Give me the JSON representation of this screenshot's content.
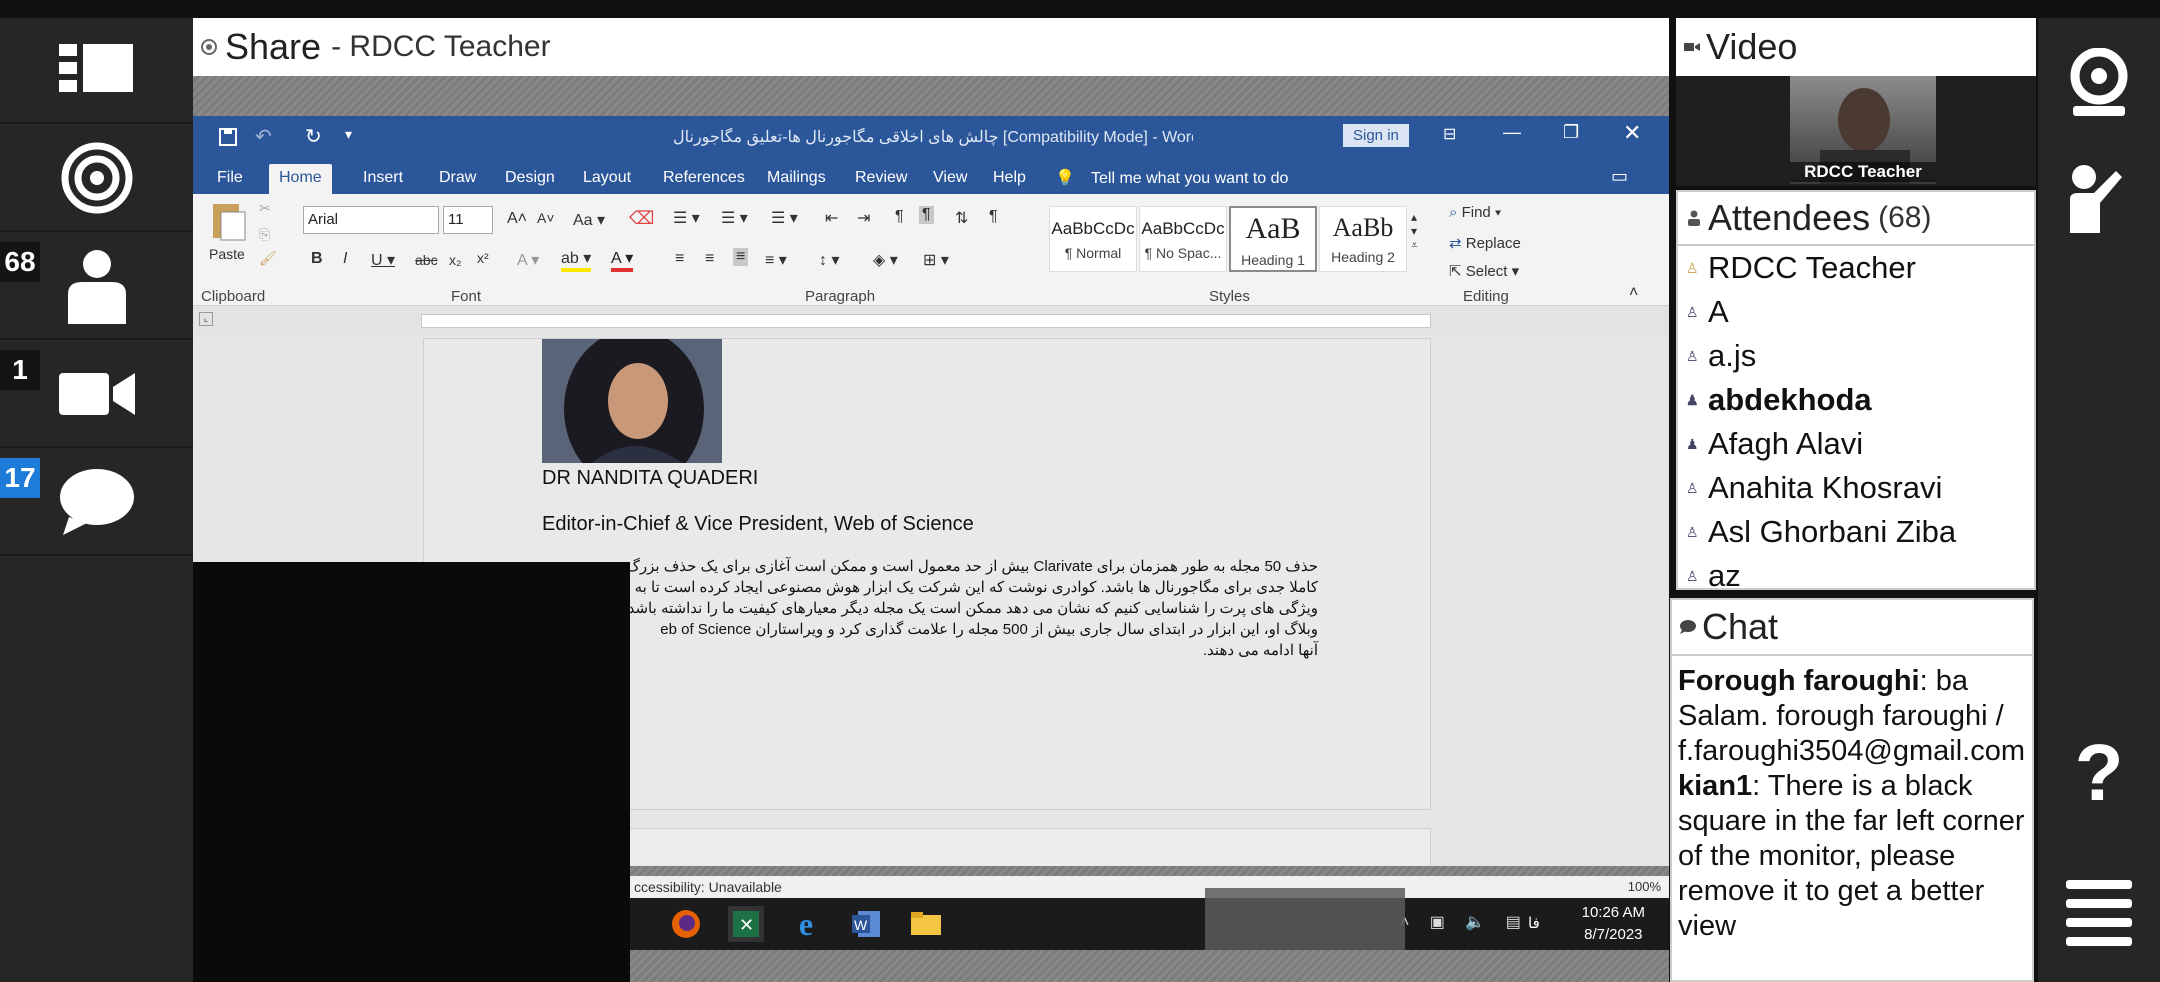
{
  "left_rail": {
    "items": [
      {
        "name": "layouts",
        "icon": "layout-grid-icon",
        "badge": ""
      },
      {
        "name": "broadcast",
        "icon": "target-icon",
        "badge": ""
      },
      {
        "name": "attendees",
        "icon": "person-icon",
        "badge": "68"
      },
      {
        "name": "video",
        "icon": "camera-icon",
        "badge": "1"
      },
      {
        "name": "chat",
        "icon": "chat-bubble-icon",
        "badge": "17"
      }
    ]
  },
  "right_rail": {
    "items": [
      "webcam-icon",
      "raise-hand-icon",
      "help-icon",
      "menu-icon"
    ],
    "help_label": "?"
  },
  "share_pod": {
    "title": "Share",
    "subtitle": "- RDCC Teacher"
  },
  "word": {
    "title": "چالش های اخلاقی مگاجورنال ها-تعلیق مگاجورنال [Compatibility Mode]  -  Word",
    "sign_in": "Sign in",
    "tabs": [
      "File",
      "Home",
      "Insert",
      "Draw",
      "Design",
      "Layout",
      "References",
      "Mailings",
      "Review",
      "View",
      "Help"
    ],
    "tell_me": "Tell me what you want to do",
    "font_name": "Arial",
    "font_size": "11",
    "paste_label": "Paste",
    "groups": [
      "Clipboard",
      "Font",
      "Paragraph",
      "Styles",
      "Editing"
    ],
    "styles": [
      {
        "preview": "AaBbCcDc",
        "name": "¶ Normal"
      },
      {
        "preview": "AaBbCcDc",
        "name": "¶ No Spac..."
      },
      {
        "preview": "AaB",
        "name": "Heading 1"
      },
      {
        "preview": "AaBb",
        "name": "Heading 2"
      }
    ],
    "editing": [
      "Find",
      "Replace",
      "Select"
    ],
    "doc": {
      "name": "DR NANDITA QUADERI",
      "role": "Editor-in-Chief & Vice President, Web of Science",
      "rtl_lines": [
        "حذف 50 مجله به طور همزمان برای Clarivate بیش از حد معمول است و ممکن است آغازی برای یک حذف بزرگ",
        "کاملا جدی برای مگاجورنال ها باشد. کوادری نوشت که این شرکت یک ابزار هوش مصنوعی ایجاد کرده است تا به",
        "ویژگی های پرت را شناسایی کنیم که نشان می دهد ممکن است یک مجله دیگر معیارهای کیفیت ما را نداشته باشد. بر",
        "وبلاگ او، این ابزار در ابتدای سال جاری بیش از 500 مجله را علامت گذاری کرد و ویراستاران eb of Science",
        "آنها ادامه می دهند."
      ]
    },
    "status_text": "ccessibility: Unavailable",
    "zoom": "100%",
    "clock_time": "10:26 AM",
    "clock_date": "8/7/2023",
    "lang": "فا"
  },
  "video_pod": {
    "title": "Video",
    "participant": "RDCC Teacher"
  },
  "attendees_pod": {
    "title": "Attendees",
    "count": "(68)",
    "rows": [
      {
        "name": "RDCC Teacher",
        "bold": false
      },
      {
        "name": "A",
        "bold": false
      },
      {
        "name": "a.js",
        "bold": false
      },
      {
        "name": "abdekhoda",
        "bold": true
      },
      {
        "name": "Afagh Alavi",
        "bold": false
      },
      {
        "name": "Anahita Khosravi",
        "bold": false
      },
      {
        "name": "Asl Ghorbani Ziba",
        "bold": false
      },
      {
        "name": "az",
        "bold": false
      }
    ]
  },
  "chat_pod": {
    "title": "Chat",
    "messages": [
      {
        "from": "Forough faroughi",
        "text": ": ba Salam. forough faroughi / f.faroughi3504@gmail.com"
      },
      {
        "from": "kian1",
        "text": ": There is a black square in the far left corner of the monitor, please remove it to get a better view"
      }
    ]
  }
}
